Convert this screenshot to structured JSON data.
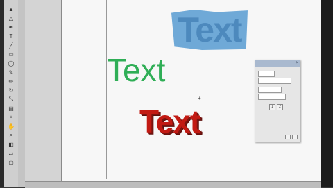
{
  "canvas": {
    "texts": [
      {
        "id": "blue",
        "value": "Text",
        "color": "#6fa9d7",
        "style": "bold filled"
      },
      {
        "id": "green",
        "value": "Text",
        "color": "#2fae56",
        "style": "regular"
      },
      {
        "id": "red",
        "value": "Text",
        "color": "#c21a13",
        "style": "bold shadow"
      }
    ]
  },
  "toolbar": {
    "tools": [
      {
        "icon": "selection-arrow-icon",
        "glyph": "▲"
      },
      {
        "icon": "direct-select-icon",
        "glyph": "△"
      },
      {
        "icon": "pen-icon",
        "glyph": "✒"
      },
      {
        "icon": "type-icon",
        "glyph": "T"
      },
      {
        "icon": "line-icon",
        "glyph": "╱"
      },
      {
        "icon": "rectangle-icon",
        "glyph": "▭"
      },
      {
        "icon": "ellipse-icon",
        "glyph": "◯"
      },
      {
        "icon": "brush-icon",
        "glyph": "✎"
      },
      {
        "icon": "pencil-icon",
        "glyph": "✏"
      },
      {
        "icon": "rotate-icon",
        "glyph": "↻"
      },
      {
        "icon": "scale-icon",
        "glyph": "⤡"
      },
      {
        "icon": "gradient-icon",
        "glyph": "▤"
      },
      {
        "icon": "eyedropper-icon",
        "glyph": "⌖"
      },
      {
        "icon": "hand-icon",
        "glyph": "✋"
      },
      {
        "icon": "zoom-icon",
        "glyph": "⌕"
      },
      {
        "icon": "fill-stroke-icon",
        "glyph": "◧"
      },
      {
        "icon": "swap-icon",
        "glyph": "⇄"
      },
      {
        "icon": "screen-mode-icon",
        "glyph": "▢"
      }
    ]
  },
  "panel": {
    "close_glyph": "×",
    "btn_glyphs": [
      "1",
      "2"
    ]
  },
  "icons": {
    "cursor": "crosshair-cursor-icon"
  }
}
